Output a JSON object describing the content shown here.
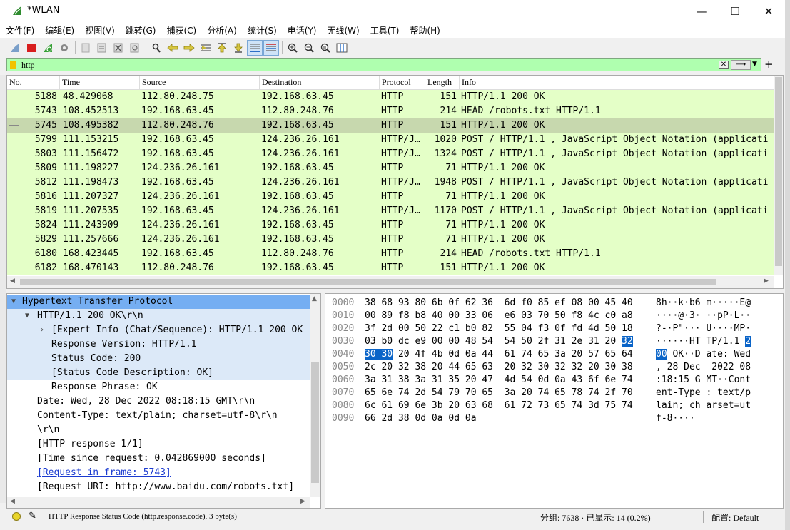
{
  "window": {
    "title": "*WLAN",
    "minimize": "—",
    "maximize": "☐",
    "close": "✕"
  },
  "menu": [
    "文件(F)",
    "编辑(E)",
    "视图(V)",
    "跳转(G)",
    "捕获(C)",
    "分析(A)",
    "统计(S)",
    "电话(Y)",
    "无线(W)",
    "工具(T)",
    "帮助(H)"
  ],
  "toolbar_icons": [
    "shark-fin-start-icon",
    "stop-icon",
    "restart-icon",
    "options-gear-icon",
    "open-file-icon",
    "file-set-icon",
    "close-file-icon",
    "reload-icon",
    "find-icon",
    "go-back-icon",
    "go-forward-icon",
    "go-to-packet-icon",
    "go-first-icon",
    "go-last-icon",
    "auto-scroll-icon",
    "colorize-icon",
    "zoom-in-icon",
    "zoom-out-icon",
    "zoom-normal-icon",
    "resize-columns-icon"
  ],
  "filter": {
    "value": "http",
    "apply": "⟶"
  },
  "packet_list": {
    "headers": [
      "No.",
      "Time",
      "Source",
      "Destination",
      "Protocol",
      "Length",
      "Info"
    ],
    "rows": [
      {
        "no": "5188",
        "time": "48.429068",
        "src": "112.80.248.75",
        "dst": "192.168.63.45",
        "proto": "HTTP",
        "len": "151",
        "info": "HTTP/1.1 200 OK"
      },
      {
        "no": "5743",
        "time": "108.452513",
        "src": "192.168.63.45",
        "dst": "112.80.248.76",
        "proto": "HTTP",
        "len": "214",
        "info": "HEAD /robots.txt HTTP/1.1"
      },
      {
        "no": "5745",
        "time": "108.495382",
        "src": "112.80.248.76",
        "dst": "192.168.63.45",
        "proto": "HTTP",
        "len": "151",
        "info": "HTTP/1.1 200 OK"
      },
      {
        "no": "5799",
        "time": "111.153215",
        "src": "192.168.63.45",
        "dst": "124.236.26.161",
        "proto": "HTTP/J…",
        "len": "1020",
        "info": "POST / HTTP/1.1 , JavaScript Object Notation (applicati"
      },
      {
        "no": "5803",
        "time": "111.156472",
        "src": "192.168.63.45",
        "dst": "124.236.26.161",
        "proto": "HTTP/J…",
        "len": "1324",
        "info": "POST / HTTP/1.1 , JavaScript Object Notation (applicati"
      },
      {
        "no": "5809",
        "time": "111.198227",
        "src": "124.236.26.161",
        "dst": "192.168.63.45",
        "proto": "HTTP",
        "len": "71",
        "info": "HTTP/1.1 200 OK"
      },
      {
        "no": "5812",
        "time": "111.198473",
        "src": "192.168.63.45",
        "dst": "124.236.26.161",
        "proto": "HTTP/J…",
        "len": "1948",
        "info": "POST / HTTP/1.1 , JavaScript Object Notation (applicati"
      },
      {
        "no": "5816",
        "time": "111.207327",
        "src": "124.236.26.161",
        "dst": "192.168.63.45",
        "proto": "HTTP",
        "len": "71",
        "info": "HTTP/1.1 200 OK"
      },
      {
        "no": "5819",
        "time": "111.207535",
        "src": "192.168.63.45",
        "dst": "124.236.26.161",
        "proto": "HTTP/J…",
        "len": "1170",
        "info": "POST / HTTP/1.1 , JavaScript Object Notation (applicati"
      },
      {
        "no": "5824",
        "time": "111.243909",
        "src": "124.236.26.161",
        "dst": "192.168.63.45",
        "proto": "HTTP",
        "len": "71",
        "info": "HTTP/1.1 200 OK"
      },
      {
        "no": "5829",
        "time": "111.257666",
        "src": "124.236.26.161",
        "dst": "192.168.63.45",
        "proto": "HTTP",
        "len": "71",
        "info": "HTTP/1.1 200 OK"
      },
      {
        "no": "6180",
        "time": "168.423445",
        "src": "192.168.63.45",
        "dst": "112.80.248.76",
        "proto": "HTTP",
        "len": "214",
        "info": "HEAD /robots.txt HTTP/1.1"
      },
      {
        "no": "6182",
        "time": "168.470143",
        "src": "112.80.248.76",
        "dst": "192.168.63.45",
        "proto": "HTTP",
        "len": "151",
        "info": "HTTP/1.1 200 OK"
      }
    ]
  },
  "details": [
    "Hypertext Transfer Protocol",
    "HTTP/1.1 200 OK\\r\\n",
    "[Expert Info (Chat/Sequence): HTTP/1.1 200 OK",
    "Response Version: HTTP/1.1",
    "Status Code: 200",
    "[Status Code Description: OK]",
    "Response Phrase: OK",
    "Date: Wed, 28 Dec 2022 08:18:15 GMT\\r\\n",
    "Content-Type: text/plain; charset=utf-8\\r\\n",
    "\\r\\n",
    "[HTTP response 1/1]",
    "[Time since request: 0.042869000 seconds]",
    "[Request in frame: 5743]",
    "[Request URI: http://www.baidu.com/robots.txt]"
  ],
  "bytes": [
    {
      "off": "0000",
      "pre": "38 68 93 80 6b 0f 62 36  6d f0 85 ef 08 00 45 40",
      "sel": "",
      "post": "",
      "apre": "8h··k·b6 m·····E@",
      "asel": "",
      "apost": ""
    },
    {
      "off": "0010",
      "pre": "00 89 f8 b8 40 00 33 06  e6 03 70 50 f8 4c c0 a8",
      "sel": "",
      "post": "",
      "apre": "····@·3· ··pP·L··",
      "asel": "",
      "apost": ""
    },
    {
      "off": "0020",
      "pre": "3f 2d 00 50 22 c1 b0 82  55 04 f3 0f fd 4d 50 18",
      "sel": "",
      "post": "",
      "apre": "?-·P\"··· U····MP·",
      "asel": "",
      "apost": ""
    },
    {
      "off": "0030",
      "pre": "03 b0 dc e9 00 00 48 54  54 50 2f 31 2e 31 20 ",
      "sel": "32",
      "post": "",
      "apre": "······HT TP/1.1 ",
      "asel": "2",
      "apost": ""
    },
    {
      "off": "0040",
      "pre": "",
      "sel": "30 30",
      "post": " 20 4f 4b 0d 0a 44  61 74 65 3a 20 57 65 64",
      "apre": "",
      "asel": "00",
      "apost": " OK··D ate: Wed"
    },
    {
      "off": "0050",
      "pre": "2c 20 32 38 20 44 65 63  20 32 30 32 32 20 30 38",
      "sel": "",
      "post": "",
      "apre": ", 28 Dec  2022 08",
      "asel": "",
      "apost": ""
    },
    {
      "off": "0060",
      "pre": "3a 31 38 3a 31 35 20 47  4d 54 0d 0a 43 6f 6e 74",
      "sel": "",
      "post": "",
      "apre": ":18:15 G MT··Cont",
      "asel": "",
      "apost": ""
    },
    {
      "off": "0070",
      "pre": "65 6e 74 2d 54 79 70 65  3a 20 74 65 78 74 2f 70",
      "sel": "",
      "post": "",
      "apre": "ent-Type : text/p",
      "asel": "",
      "apost": ""
    },
    {
      "off": "0080",
      "pre": "6c 61 69 6e 3b 20 63 68  61 72 73 65 74 3d 75 74",
      "sel": "",
      "post": "",
      "apre": "lain; ch arset=ut",
      "asel": "",
      "apost": ""
    },
    {
      "off": "0090",
      "pre": "66 2d 38 0d 0a 0d 0a",
      "sel": "",
      "post": "",
      "apre": "f-8····",
      "asel": "",
      "apost": ""
    }
  ],
  "status": {
    "field": "HTTP Response Status Code (http.response.code), 3 byte(s)",
    "packets": "分组: 7638 · 已显示: 14 (0.2%)",
    "profile": "配置: Default"
  },
  "colors": {
    "row_bg": "#e4ffc7",
    "row_selected": "#c7d8ae",
    "filter_bg": "#afffaf",
    "detail_highlight": "#75aef2",
    "byte_selection": "#0a64c8"
  }
}
